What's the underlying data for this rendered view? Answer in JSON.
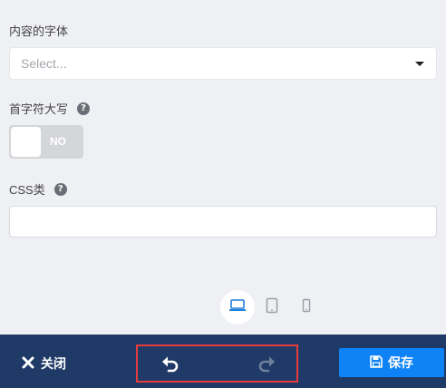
{
  "fields": {
    "font": {
      "label": "内容的字体",
      "placeholder": "Select..."
    },
    "capitalize": {
      "label": "首字符大写",
      "help": "?",
      "toggle_text": "NO",
      "toggle_on": false
    },
    "css_class": {
      "label": "CSS类",
      "help": "?",
      "value": ""
    }
  },
  "device_toggle": {
    "items": [
      "desktop-icon",
      "tablet-icon",
      "mobile-icon"
    ],
    "active": "desktop"
  },
  "footer": {
    "close_label": "关闭",
    "save_label": "保存",
    "undo_icon": "undo-icon",
    "redo_icon": "redo-icon"
  },
  "colors": {
    "background": "#eff0f4",
    "footer": "#1f3a67",
    "save_button": "#0f82f5",
    "highlight_border": "#e53b3b",
    "active_device": "#1f7fd8"
  }
}
